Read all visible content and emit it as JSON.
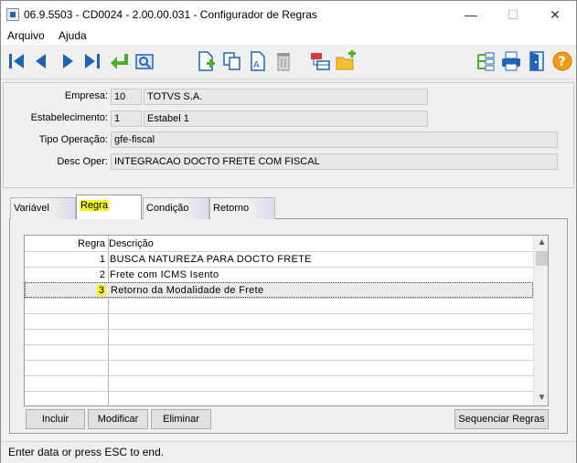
{
  "window": {
    "title": "06.9.5503 - CD0024 - 2.00.00.031 - Configurador de Regras",
    "minimize": "—",
    "maximize": "☐",
    "close": "✕"
  },
  "menu": {
    "items": [
      "Arquivo",
      "Ajuda"
    ]
  },
  "toolbar": {
    "icons": [
      "first-record-icon",
      "previous-record-icon",
      "next-record-icon",
      "last-record-icon",
      "go-to-icon",
      "search-icon",
      "new-icon",
      "copy-icon",
      "edit-icon",
      "delete-icon",
      "related-icon",
      "new-folder-icon",
      "tree-icon",
      "print-icon",
      "exit-icon",
      "help-icon"
    ],
    "help_label": "?"
  },
  "header": {
    "empresa_label": "Empresa:",
    "empresa_code": "10",
    "empresa_name": "TOTVS S.A.",
    "estab_label": "Estabelecimento:",
    "estab_code": "1",
    "estab_name": "Estabel 1",
    "tipo_label": "Tipo Operação:",
    "tipo_value": "gfe-fiscal",
    "desc_label": "Desc Oper:",
    "desc_value": "INTEGRACAO DOCTO FRETE COM FISCAL"
  },
  "tabs": [
    "Variável",
    "Regra",
    "Condição",
    "Retorno"
  ],
  "active_tab": "Regra",
  "grid": {
    "columns": [
      "Regra",
      "Descrição"
    ],
    "rows": [
      {
        "regra": "1",
        "descricao": "BUSCA NATUREZA PARA DOCTO FRETE"
      },
      {
        "regra": "2",
        "descricao": "Frete com ICMS Isento"
      },
      {
        "regra": "3",
        "descricao": "Retorno da Modalidade de Frete"
      }
    ],
    "selected_row": "3"
  },
  "buttons": {
    "incluir": "Incluir",
    "modificar": "Modificar",
    "eliminar": "Eliminar",
    "sequenciar": "Sequenciar Regras"
  },
  "status": "Enter data or press ESC to end.",
  "colors": {
    "highlight": "#f6f62a",
    "toolbar_blue": "#1f63b8",
    "toolbar_green": "#4caf2e"
  }
}
